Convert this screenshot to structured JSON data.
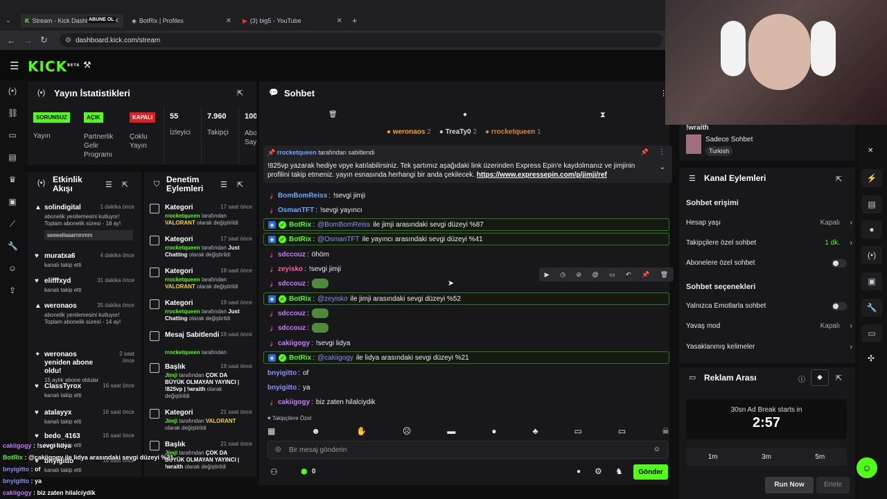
{
  "browser": {
    "tabs": [
      {
        "title": "Stream - Kick Dashboard",
        "overlay": "ABUNE OL"
      },
      {
        "title": "BotRix | Profiles"
      },
      {
        "title": "(3) big5 - YouTube"
      }
    ],
    "url": "dashboard.kick.com/stream"
  },
  "header": {
    "logo": "KICK",
    "beta": "BETA"
  },
  "stats": {
    "title": "Yayın İstatistikleri",
    "items": [
      {
        "badge": "SORUNSUZ",
        "color": "#53fc18",
        "label": "Yayın"
      },
      {
        "badge": "AÇIK",
        "color": "#53fc18",
        "label": "Partnerlik Gelir Programı"
      },
      {
        "badge": "KAPALI",
        "color": "#e02020",
        "label": "Çoklu Yayın"
      },
      {
        "value": "55",
        "label": "İzleyici"
      },
      {
        "value": "7.960",
        "label": "Takipçi"
      },
      {
        "value": "100",
        "label": "Abo Sayı"
      }
    ]
  },
  "activity": {
    "title": "Etkinlik Akışı",
    "items": [
      {
        "name": "solindigital",
        "time": "1 dakika önce",
        "sub": "abonelik yenilemesini kutluyor! Toplam abonelik süresi - 18 ay!",
        "note": "seeeellaaammmm"
      },
      {
        "name": "muratxa6",
        "time": "4 dakika önce",
        "sub": "kanalı takip etti"
      },
      {
        "name": "elifffxyd",
        "time": "31 dakika önce",
        "sub": "kanalı takip etti"
      },
      {
        "name": "weronaos",
        "time": "35 dakika önce",
        "sub": "abonelik yenilemesini kutluyor! Toplam abonelik süresi - 14 ay!"
      },
      {
        "name": "weronaos yeniden abone oldu!",
        "time": "2 saat önce",
        "sub": "15 aylık abone oldular"
      },
      {
        "name": "ClassTyrox",
        "time": "16 saat önce",
        "sub": "kanalı takip etti"
      },
      {
        "name": "atalayyx",
        "time": "16 saat önce",
        "sub": "kanalı takip etti"
      },
      {
        "name": "bedo_4163",
        "time": "16 saat önce",
        "sub": "kanalı takip etti"
      },
      {
        "name": "bnyigitto",
        "time": "16 saat önce",
        "sub": "kanalı takip etti"
      }
    ]
  },
  "moderation": {
    "title": "Denetim Eylemleri",
    "items": [
      {
        "name": "Kategori",
        "time": "17 saat önce",
        "by": "rrocketqueen",
        "mid": " tarafından ",
        "val": "VALORANT",
        "end": " olarak değiştirildi"
      },
      {
        "name": "Kategori",
        "time": "17 saat önce",
        "by": "rrocketqueen",
        "mid": " tarafından ",
        "val": "Just Chatting",
        "end": " olarak değiştirildi"
      },
      {
        "name": "Kategori",
        "time": "18 saat önce",
        "by": "rrocketqueen",
        "mid": " tarafından ",
        "val": "VALORANT",
        "end": " olarak değiştirildi"
      },
      {
        "name": "Kategori",
        "time": "19 saat önce",
        "by": "rrocketqueen",
        "mid": " tarafından ",
        "val": "Just Chatting",
        "end": " olarak değiştirildi"
      },
      {
        "name": "Mesaj Sabitlendi",
        "time": "19 saat önce",
        "by": "rrocketqueen",
        "mid": " tarafından",
        "val": "",
        "end": ""
      },
      {
        "name": "Başlık",
        "time": "19 saat önce",
        "by": "Jimji",
        "mid": " tarafından ",
        "val": "ÇOK DA BÜYÜK OLMAYAN YAYINCI | !825vp | !wraith",
        "end": " olarak değiştirildi"
      },
      {
        "name": "Kategori",
        "time": "21 saat önce",
        "by": "Jimji",
        "mid": " tarafından ",
        "val": "VALORANT",
        "end": " olarak değiştirildi"
      },
      {
        "name": "Başlık",
        "time": "21 saat önce",
        "by": "Jimji",
        "mid": " tarafından ",
        "val": "ÇOK DA BÜYÜK OLMAYAN YAYINCI | !wraith",
        "end": " olarak değiştirildi"
      }
    ]
  },
  "chat": {
    "title": "Sohbet",
    "top": [
      {
        "name": "weronaos",
        "count": "2"
      },
      {
        "name": "TreaTy0",
        "count": "2"
      },
      {
        "name": "rrocketqueen",
        "count": "1"
      }
    ],
    "pinned": {
      "by": "rrocketqueen",
      "label": "tarafından sabitlendi",
      "text": "!825vp yazarak hediye vpye katılabilirsiniz. Tek şartımız aşağıdaki link üzerinden Express Epin'e kaydolmanız ve jimjinin profilini takip etmeniz. yayın esnasında herhangi bir anda çekilecek.",
      "link": "https://www.expressepin.com/p/jimji/ref"
    },
    "messages": [
      {
        "user": "BomBomReiss",
        "color": "#6fa8ff",
        "text": "!sevgi jimji"
      },
      {
        "user": "OsmanTFT",
        "color": "#6fa8ff",
        "text": "!sevgi yayıncı"
      },
      {
        "user": "BotRix",
        "color": "#53fc18",
        "bot": true,
        "mention": "@BomBomReiss",
        "text": "ile jimji arasındaki sevgi düzeyi %87"
      },
      {
        "user": "BotRix",
        "color": "#53fc18",
        "bot": true,
        "mention": "@OsmanTFT",
        "text": "ile yayıncı arasındaki sevgi düzeyi %41"
      },
      {
        "user": "sdccouz",
        "color": "#c77dff",
        "text": "öhöm"
      },
      {
        "user": "zeyisko",
        "color": "#ff5fa2",
        "text": "!sevgi jimji"
      },
      {
        "user": "sdccouz",
        "color": "#c77dff",
        "text": ""
      },
      {
        "user": "BotRix",
        "color": "#53fc18",
        "bot": true,
        "mention": "@zeyisko",
        "text": "ile jimji arasındaki sevgi düzeyi %52"
      },
      {
        "user": "sdccouz",
        "color": "#c77dff",
        "text": ""
      },
      {
        "user": "sdccouz",
        "color": "#c77dff",
        "text": ""
      },
      {
        "user": "cakiigogy",
        "color": "#c77dff",
        "text": "!sevgi lidya"
      },
      {
        "user": "BotRix",
        "color": "#53fc18",
        "bot": true,
        "mention": "@cakiigogy",
        "text": "ile lidya arasındaki sevgi düzeyi %21"
      },
      {
        "user": "bnyigitto",
        "color": "#8b90ff",
        "text": "of"
      },
      {
        "user": "bnyigitto",
        "color": "#8b90ff",
        "text": "ya"
      },
      {
        "user": "cakiigogy",
        "color": "#c77dff",
        "text": "biz zaten hilalciydik"
      }
    ],
    "followers_only": "Takipçilere Özel",
    "input_placeholder": "Bir mesaj gönderin",
    "points": "0",
    "send": "Gönder"
  },
  "right": {
    "stream_title": "!wraith",
    "mode": "Sadece Sohbet",
    "lang": "Turkish",
    "channel_actions": "Kanal Eylemleri",
    "chat_access": "Sohbet erişimi",
    "rows1": [
      {
        "label": "Hesap yaşı",
        "value": "Kapalı"
      },
      {
        "label": "Takipçilere özel sohbet",
        "value": "1 dk."
      },
      {
        "label": "Abonelere özel sohbet",
        "value": ""
      }
    ],
    "chat_options": "Sohbet seçenekleri",
    "rows2": [
      {
        "label": "Yalnızca Emotlarla sohbet",
        "value": ""
      },
      {
        "label": "Yavaş mod",
        "value": "Kapalı"
      },
      {
        "label": "Yasaklanmış kelimeler",
        "value": ""
      }
    ],
    "ad": {
      "title": "Reklam Arası",
      "starts": "30sn Ad Break starts in",
      "timer": "2:57",
      "options": [
        "1m",
        "3m",
        "5m"
      ],
      "run": "Run Now",
      "delay": "Ertele"
    }
  },
  "overlay": [
    {
      "user": "cakiigogy",
      "text": " : !sevgi lidya"
    },
    {
      "user": "BotRix",
      "text": " : @cakiigogy ile lidya arasındaki sevgi düzeyi %21"
    },
    {
      "user": "bnyigitto",
      "text": " : of"
    },
    {
      "user": "bnyigitto",
      "text": " : ya"
    },
    {
      "user": "cakiigogy",
      "text": " : biz zaten hilalciydik"
    }
  ]
}
